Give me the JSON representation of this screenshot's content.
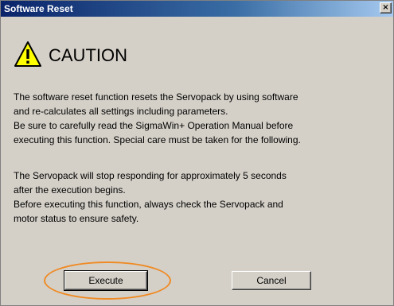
{
  "window": {
    "title": "Software Reset",
    "close_glyph": "×"
  },
  "caution": {
    "icon": "warning-triangle-icon",
    "heading": "CAUTION",
    "icon_fill": "#ffff00"
  },
  "message": {
    "paragraph1": [
      "The software reset function resets the Servopack by using software",
      "and re-calculates all settings including parameters.",
      "Be sure to carefully read the SigmaWin+ Operation Manual before",
      "executing this function. Special care must be taken for the following."
    ],
    "paragraph2": [
      "The Servopack will stop responding for approximately 5 seconds",
      "after  the execution begins.",
      "Before executing this function, always check the Servopack and",
      "motor status to ensure safety."
    ]
  },
  "buttons": {
    "execute_label": "Execute",
    "cancel_label": "Cancel"
  },
  "colors": {
    "dialog_bg": "#d4d0c8",
    "highlight": "#f08a24"
  }
}
